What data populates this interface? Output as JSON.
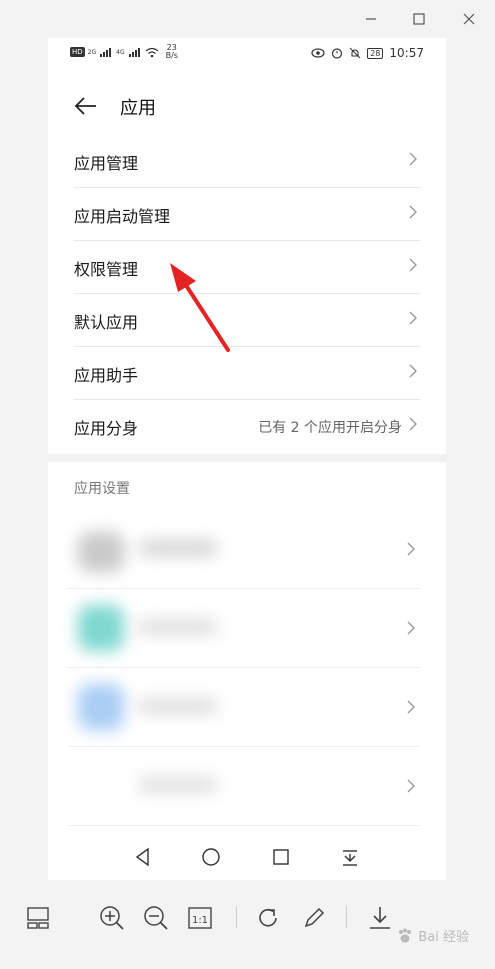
{
  "status_bar": {
    "speed_value": "23",
    "speed_unit": "B/s",
    "battery": "28",
    "time": "10:57",
    "net_label1": "2G",
    "net_label2": "4G"
  },
  "header": {
    "title": "应用"
  },
  "menu": [
    {
      "label": "应用管理",
      "value": ""
    },
    {
      "label": "应用启动管理",
      "value": ""
    },
    {
      "label": "权限管理",
      "value": ""
    },
    {
      "label": "默认应用",
      "value": ""
    },
    {
      "label": "应用助手",
      "value": ""
    },
    {
      "label": "应用分身",
      "value": "已有 2 个应用开启分身"
    }
  ],
  "settings": {
    "section_title": "应用设置",
    "apps": [
      {
        "icon_color": "#bdbdbd"
      },
      {
        "icon_color": "#7fd8d0"
      },
      {
        "icon_color": "#a9cdf5"
      },
      {
        "icon_color": "#f1f1f1"
      }
    ]
  },
  "watermark": "Bai 经验",
  "icons": {
    "window": [
      "minimize-icon",
      "maximize-icon",
      "close-icon"
    ],
    "nav": [
      "back-triangle-icon",
      "home-circle-icon",
      "recents-square-icon",
      "notification-pull-icon"
    ],
    "toolbar": [
      "layout-icon",
      "zoom-in-icon",
      "zoom-out-icon",
      "actual-size-icon",
      "rotate-icon",
      "edit-icon",
      "download-icon"
    ]
  }
}
